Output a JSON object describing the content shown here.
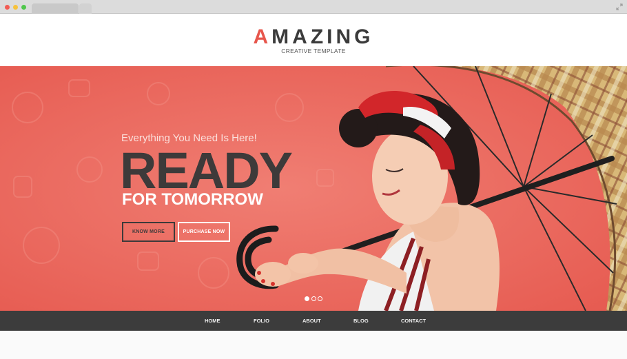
{
  "browser": {
    "window_controls": [
      "close",
      "minimize",
      "zoom"
    ],
    "expand_icon": "expand-icon"
  },
  "header": {
    "logo_first_letter": "A",
    "logo_rest": "MAZING",
    "logo_subtitle": "CREATIVE TEMPLATE"
  },
  "hero": {
    "tagline": "Everything You Need Is Here!",
    "headline": "READY",
    "subheadline": "FOR TOMORROW",
    "buttons": {
      "know_more": "KNOW MORE",
      "purchase_now": "PURCHASE NOW"
    },
    "slide_count": 3,
    "active_slide": 1
  },
  "nav": {
    "items": [
      "HOME",
      "FOLIO",
      "ABOUT",
      "BLOG",
      "CONTACT"
    ]
  },
  "colors": {
    "accent": "#e7564c",
    "hero_background": "#ec7166",
    "nav_background": "#3c3c3c",
    "dark_text": "#3d3a3a"
  }
}
